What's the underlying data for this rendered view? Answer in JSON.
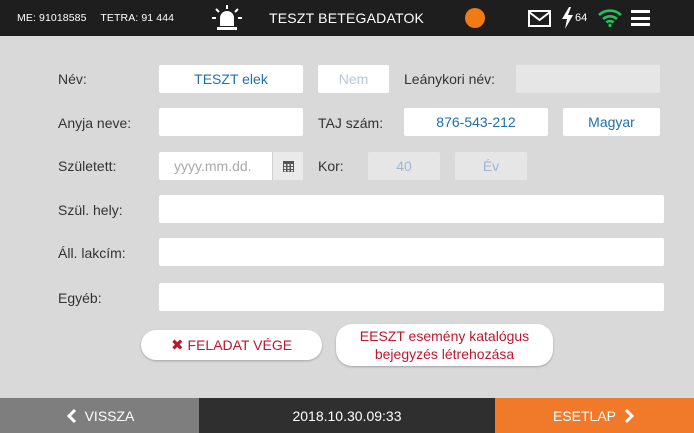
{
  "topbar": {
    "me_label": "ME:",
    "me_value": "91018585",
    "tetra_label": "TETRA:",
    "tetra_value": "91 444",
    "title": "TESZT BETEGADATOK",
    "battery": "64",
    "status_dot_color": "#f07a16",
    "icons": [
      "siren-icon",
      "envelope-icon",
      "bolt-icon",
      "wifi-icon",
      "menu-icon"
    ]
  },
  "form": {
    "nev_label": "Név:",
    "nev_value": "TESZT elek",
    "nem_placeholder": "Nem",
    "leanykori_label": "Leánykori név:",
    "leanykori_value": "",
    "anyja_label": "Anyja neve:",
    "anyja_value": "",
    "taj_label": "TAJ szám:",
    "taj_value": "876-543-212",
    "nationality": "Magyar",
    "szuletett_label": "Született:",
    "szuletett_placeholder": "yyyy.mm.dd.",
    "kor_label": "Kor:",
    "kor_value": "40",
    "kor_unit": "Év",
    "szul_hely_label": "Szül. hely:",
    "szul_hely_value": "",
    "all_lakcim_label": "Áll. lakcím:",
    "all_lakcim_value": "",
    "egyeb_label": "Egyéb:",
    "egyeb_value": ""
  },
  "buttons": {
    "feladat_vege": "FELADAT VÉGE",
    "feladat_vege_icon": "✖",
    "eeszt_line1": "EESZT esemény katalógus",
    "eeszt_line2": "bejegyzés létrehozása"
  },
  "bottom": {
    "back_label": "VISSZA",
    "date": "2018.10.30.",
    "time": "09:33",
    "next_label": "ESETLAP"
  },
  "colors": {
    "accent_orange": "#f07a2a",
    "value_blue": "#1f6fb0",
    "action_red": "#c0162c"
  }
}
